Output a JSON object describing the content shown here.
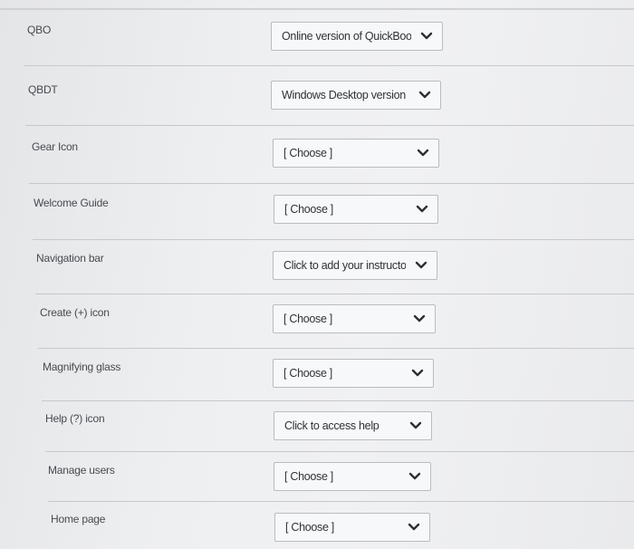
{
  "rows": [
    {
      "term": "QBO",
      "answer": "Online version of QuickBoo"
    },
    {
      "term": "QBDT",
      "answer": "Windows Desktop version"
    },
    {
      "term": "Gear Icon",
      "answer": "[ Choose ]"
    },
    {
      "term": "Welcome Guide",
      "answer": "[ Choose ]"
    },
    {
      "term": "Navigation bar",
      "answer": "Click to add your instructor"
    },
    {
      "term": "Create (+) icon",
      "answer": "[ Choose ]"
    },
    {
      "term": "Magnifying glass",
      "answer": "[ Choose ]"
    },
    {
      "term": "Help (?) icon",
      "answer": "Click to access help"
    },
    {
      "term": "Manage users",
      "answer": "[ Choose ]"
    },
    {
      "term": "Home page",
      "answer": "[ Choose ]"
    }
  ],
  "icons": {
    "dropdown": "chevron-down-icon"
  },
  "colors": {
    "background": "#eceef0",
    "select_border": "#b9bcc1",
    "text": "#3c3f44"
  }
}
